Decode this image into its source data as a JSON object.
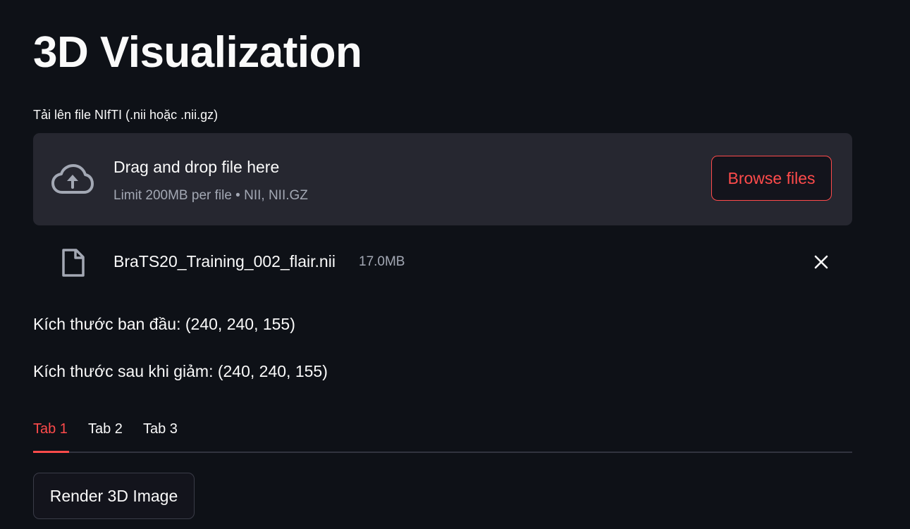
{
  "page": {
    "title": "3D Visualization"
  },
  "uploader": {
    "label": "Tải lên file NIfTI (.nii hoặc .nii.gz)",
    "dropzone_title": "Drag and drop file here",
    "dropzone_subtitle": "Limit 200MB per file • NII, NII.GZ",
    "browse_label": "Browse files",
    "icon": "cloud-upload-icon"
  },
  "uploaded_file": {
    "name": "BraTS20_Training_002_flair.nii",
    "size": "17.0MB",
    "icon": "file-icon",
    "remove_icon": "close-icon"
  },
  "info": {
    "original_size": "Kích thước ban đầu: (240, 240, 155)",
    "reduced_size": "Kích thước sau khi giảm: (240, 240, 155)"
  },
  "tabs": [
    {
      "label": "Tab 1",
      "active": true
    },
    {
      "label": "Tab 2",
      "active": false
    },
    {
      "label": "Tab 3",
      "active": false
    }
  ],
  "actions": {
    "render_label": "Render 3D Image"
  },
  "colors": {
    "background": "#0e1117",
    "surface": "#262730",
    "accent": "#ff4b4b",
    "text": "#fafafa",
    "muted_text": "#a3a8b4"
  }
}
